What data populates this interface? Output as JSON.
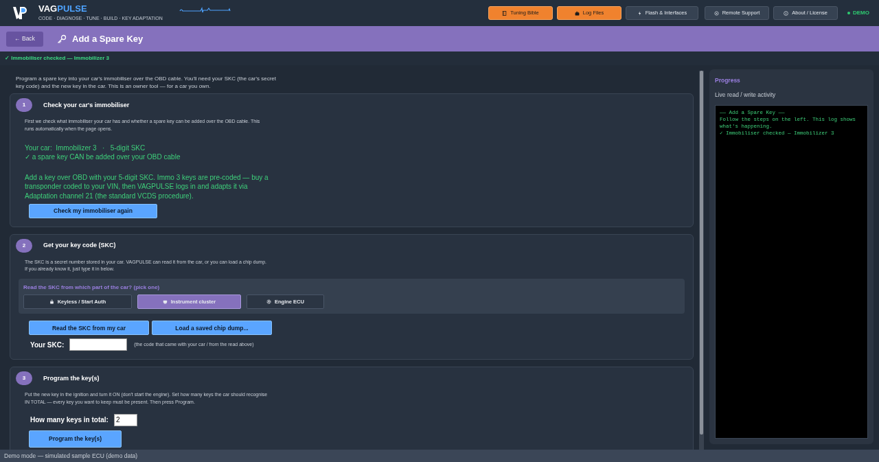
{
  "app": {
    "brand_a": "VAG",
    "brand_b": "PULSE",
    "tagline": "CODE · DIAGNOSE · TUNE · BUILD · KEY ADAPTATION"
  },
  "nav": [
    {
      "label": "Tuning Bible",
      "kind": "orange"
    },
    {
      "label": "Log Files",
      "kind": "orange"
    },
    {
      "label": "Flash & Interfaces",
      "kind": "dark"
    },
    {
      "label": "Remote Support",
      "kind": "dark"
    },
    {
      "label": "About / License",
      "kind": "dark"
    }
  ],
  "mode": {
    "label": "DEMO",
    "color": "#2ecc71"
  },
  "page": {
    "back": "← Back",
    "title": "Add a Spare Key"
  },
  "status_line": "✓ Immobiliser checked — Immobilizer 3",
  "intro": "Program a spare key into your car's immobiliser over the OBD cable. You'll need your SKC (the car's secret key code) and the new key in the car. This is an owner tool — for a car you own.",
  "steps": [
    {
      "number": "1",
      "title": "Check your car's immobiliser",
      "description": "First we check what immobiliser your car has and whether a spare key can be added over the OBD cable. This runs automatically when the page opens.",
      "result": [
        "Your car:  Immobilizer 3   ·   5-digit SKC",
        "✓ a spare key CAN be added over your OBD cable"
      ],
      "advice": "Add a key over OBD with your 5-digit SKC. Immo 3 keys are pre-coded — buy a transponder coded to your VIN, then VAGPULSE logs in and adapts it via Adaptation channel 21 (the standard VCDS procedure).",
      "buttons": [
        "Check my immobiliser again"
      ]
    },
    {
      "number": "2",
      "title": "Get your key code (SKC)",
      "description": "The SKC is a secret number stored in your car. VAGPULSE can read it from the car, or you can load a chip dump. If you already know it, just type it in below.",
      "source": {
        "question": "Read the SKC from which part of the car?  (pick one)",
        "options": [
          {
            "label": "Keyless / Start Auth",
            "selected": false
          },
          {
            "label": "Instrument cluster",
            "selected": true
          },
          {
            "label": "Engine ECU",
            "selected": false
          }
        ]
      },
      "buttons": [
        "Read the SKC from my car",
        "Load a saved chip dump..."
      ],
      "field": {
        "label": "Your SKC:",
        "hint": "(the code that came with your car / from the read above)"
      }
    },
    {
      "number": "3",
      "title": "Program the key(s)",
      "description": "Put the new key in the ignition and turn it ON (don't start the engine). Set how many keys the car should recognise IN TOTAL — every key you want to keep must be present. Then press Program.",
      "count": {
        "label": "How many keys in total:",
        "value": "2"
      },
      "buttons": [
        "Program the key(s)"
      ]
    }
  ],
  "progress": {
    "title": "Progress",
    "subtitle": "Live read / write activity",
    "log": [
      "——  Add a Spare Key  ——",
      "Follow the steps on the left. This log shows what's happening.",
      "✓ Immobiliser checked — Immobilizer 3"
    ]
  },
  "status_bar": "Demo mode — simulated sample ECU (demo data)"
}
